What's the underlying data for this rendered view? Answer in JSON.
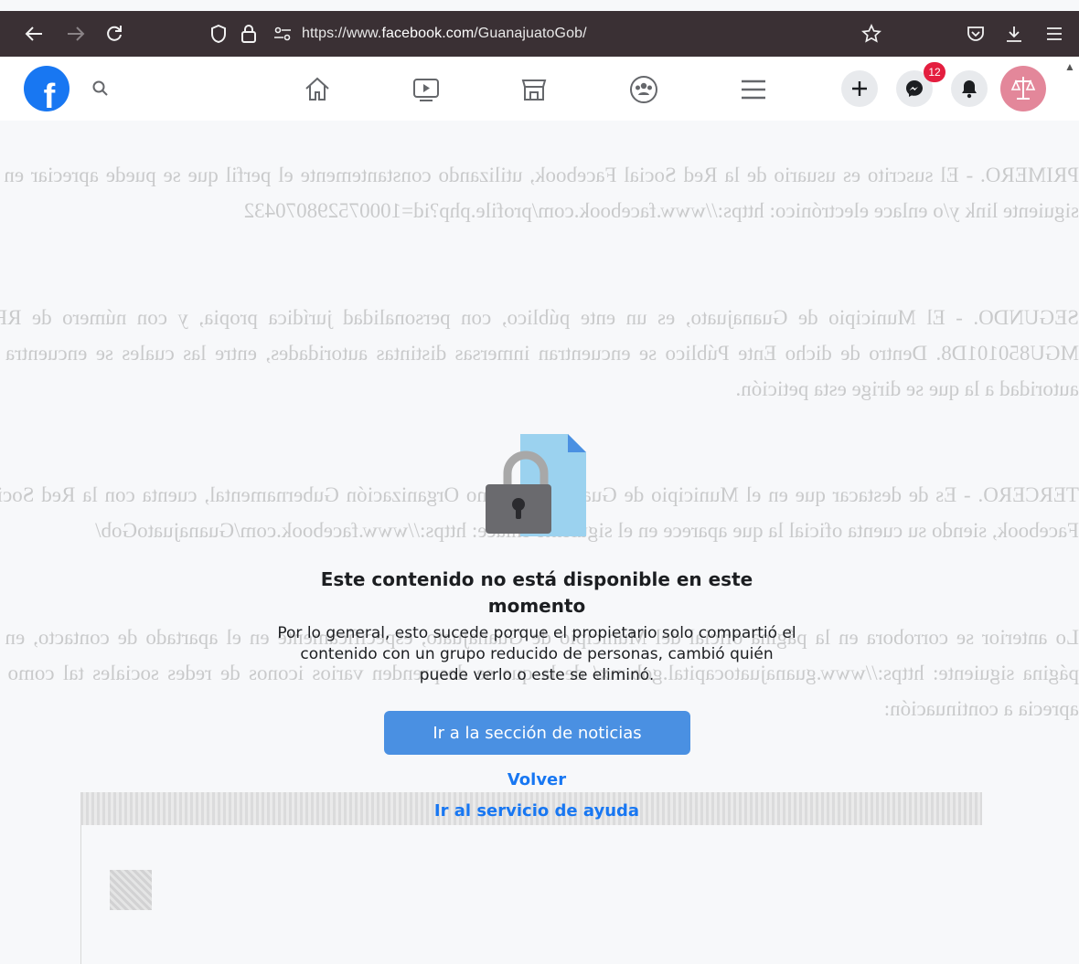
{
  "browser": {
    "url_prefix": "https://www.",
    "url_domain": "facebook.com",
    "url_path": "/GuanajuatoGob/"
  },
  "header": {
    "logo_letter": "f",
    "notification_count": "12"
  },
  "background_document": {
    "paragraphs": [
      "PRIMERO. - El suscrito es usuario de la Red Social Facebook, utilizando constantemente el perfil que se puede apreciar en el siguiente link y/o enlace electrónico: https://www.facebook.com/profile.php?id=100075298070432",
      "SEGUNDO. - El Municipio de Guanajuato, es un ente público, con personalidad jurídica propia, y con número de RFC MGU850101D8. Dentro de dicho Ente Público se encuentran inmersas distintas autoridades, entre las cuales se encuentra la autoridad a la que se dirige esta petición.",
      "TERCERO. - Es de destacar que en el Municipio de Guanajuato como Organización Gubernamental, cuenta con la Red Social Facebook, siendo su cuenta oficial la que aparece en el siguiente enlace: https://www.facebook.com/GuanajuatoGob/",
      "Lo anterior se corrobora en la página oficial del Municipio de Guanajuato, específicamente en el apartado de contacto, en la página siguiente: https://www.guanajuatocapital.gob.mx/ de la que se desprenden varios iconos de redes sociales tal como se aprecia a continuación:"
    ]
  },
  "message": {
    "title": "Este contenido no está disponible en este momento",
    "body": "Por lo general, esto sucede porque el propietario solo compartió el contenido con un grupo reducido de personas, cambió quién puede verlo o este se eliminó.",
    "primary_button": "Ir a la sección de noticias",
    "back_link": "Volver",
    "help_link": "Ir al servicio de ayuda"
  },
  "colors": {
    "browser_toolbar": "#3a3034",
    "facebook_blue": "#1877f2",
    "button_blue": "#4a90e2",
    "badge_red": "#e41e3f"
  }
}
